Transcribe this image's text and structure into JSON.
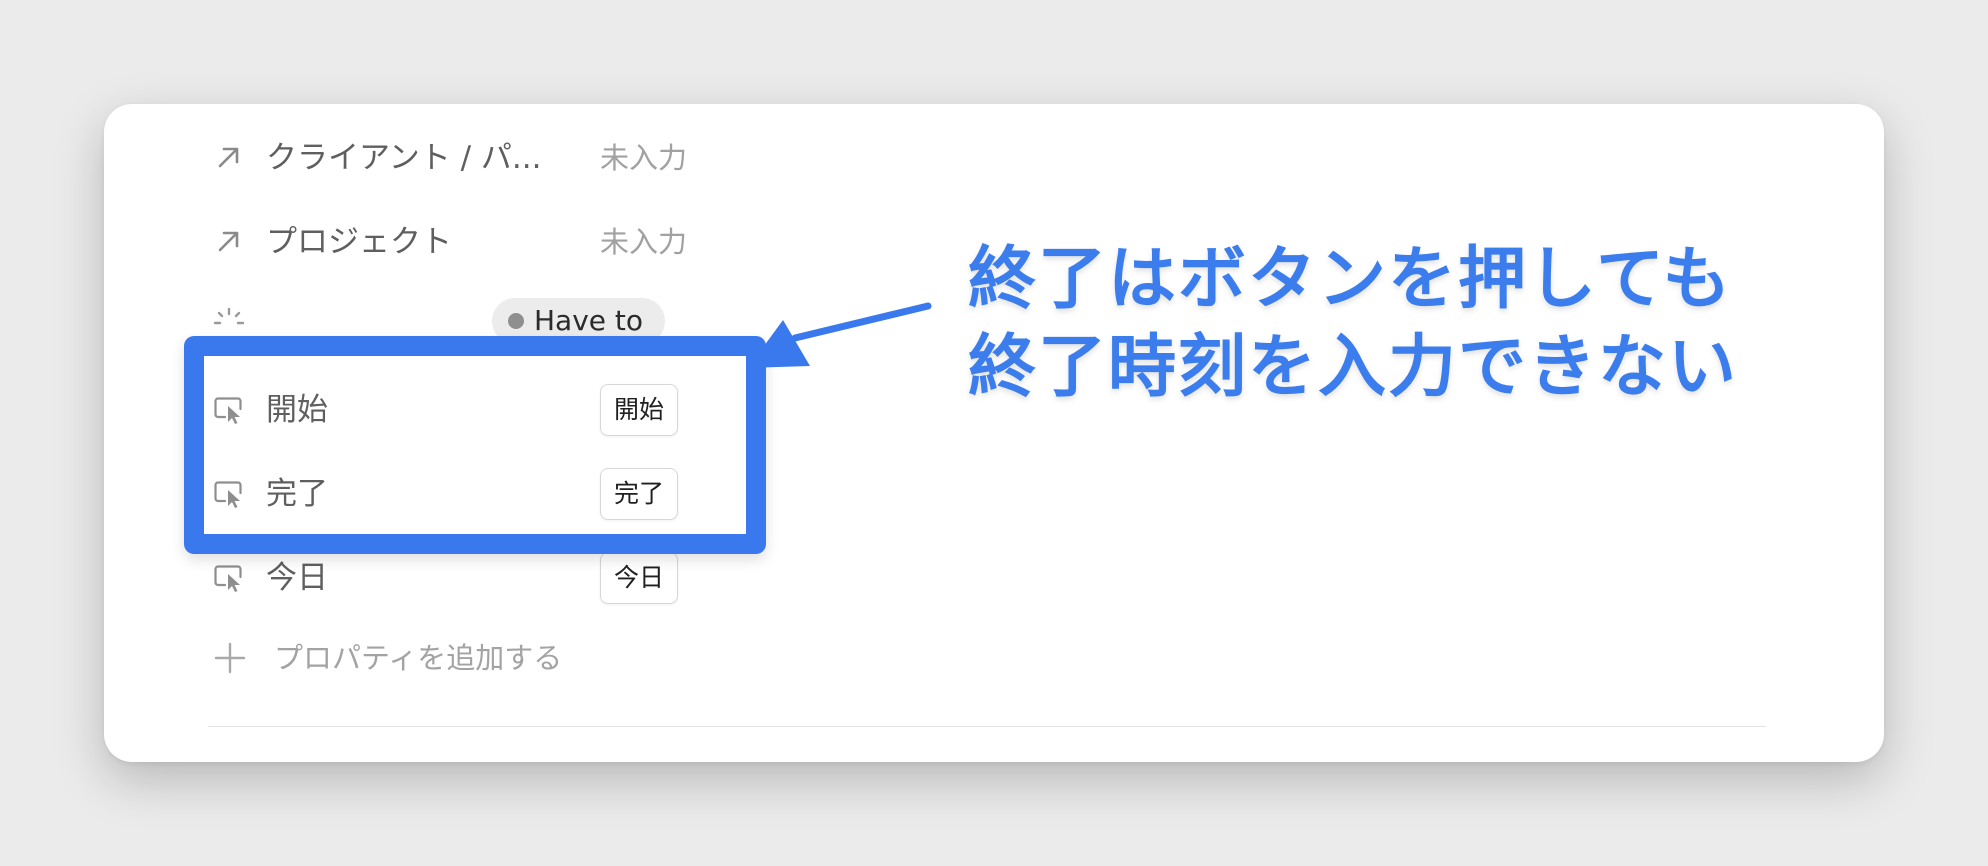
{
  "properties": [
    {
      "icon": "relation-arrow-icon",
      "label": "クライアント / パ...",
      "value": "未入力"
    },
    {
      "icon": "relation-arrow-icon",
      "label": "プロジェクト",
      "value": "未入力"
    }
  ],
  "status": {
    "icon": "status-loader-icon",
    "label": "",
    "tag": "Have to",
    "dot_color": "#8f8f8f"
  },
  "buttons": [
    {
      "icon": "button-cursor-icon",
      "label": "開始",
      "button_text": "開始"
    },
    {
      "icon": "button-cursor-icon",
      "label": "完了",
      "button_text": "完了"
    },
    {
      "icon": "button-cursor-icon",
      "label": "今日",
      "button_text": "今日"
    }
  ],
  "add_property": {
    "icon": "plus-icon",
    "label": "プロパティを追加する"
  },
  "annotation": {
    "line1": "終了はボタンを押しても",
    "line2": "終了時刻を入力できない",
    "color": "#3b7ded"
  }
}
